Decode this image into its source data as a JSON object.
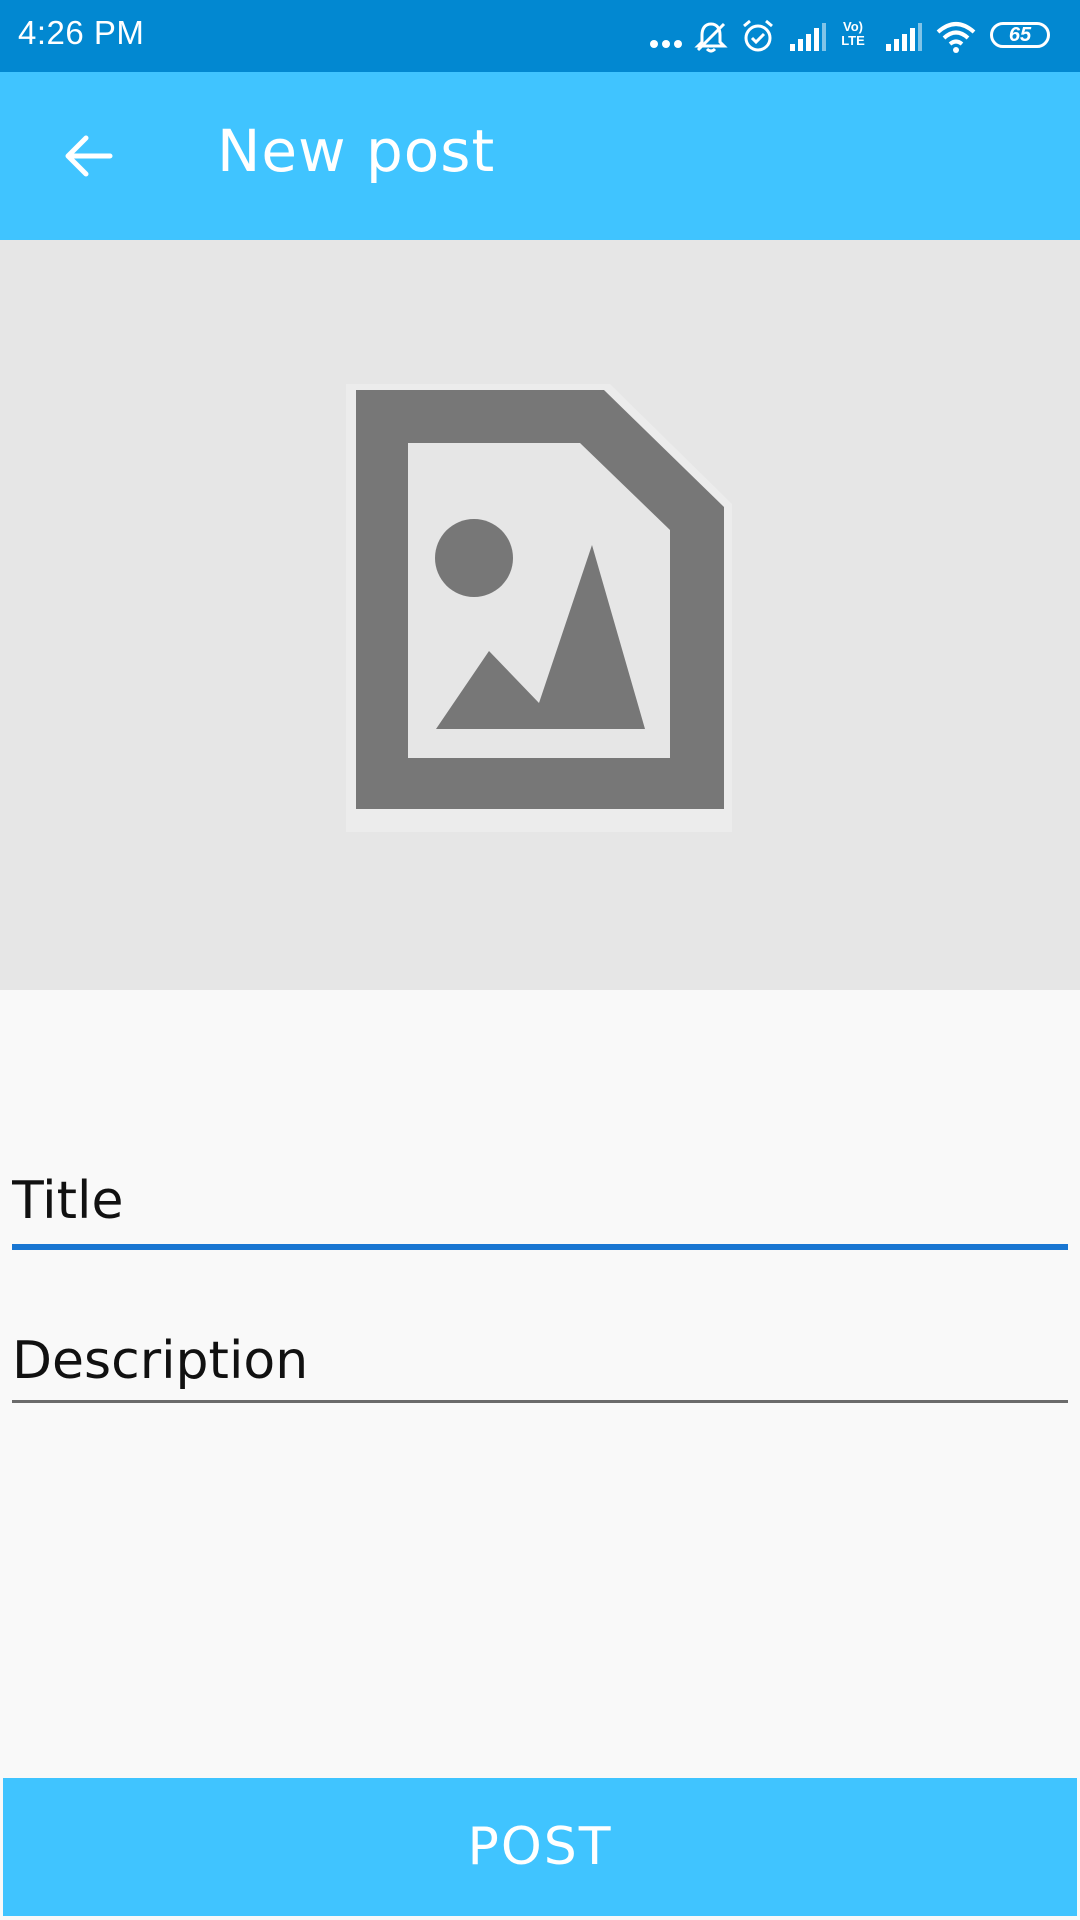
{
  "status_bar": {
    "time": "4:26 PM",
    "battery_level": "65",
    "network_label": "Vo) LTE",
    "icons": [
      "more-dots-icon",
      "bell-off-icon",
      "alarm-icon",
      "signal-icon",
      "volte-icon",
      "signal-icon",
      "wifi-icon",
      "battery-icon"
    ]
  },
  "app_bar": {
    "title": "New post",
    "back_icon": "arrow-back-icon"
  },
  "image_picker": {
    "icon": "image-placeholder-icon"
  },
  "form": {
    "title_placeholder": "Title",
    "title_value": "",
    "description_placeholder": "Description",
    "description_value": ""
  },
  "actions": {
    "post_label": "POST"
  },
  "colors": {
    "status_bar": "#0288d1",
    "primary": "#40c4ff",
    "image_bg": "#e6e6e6",
    "icon_gray": "#777777",
    "focus_underline": "#1976d2"
  }
}
